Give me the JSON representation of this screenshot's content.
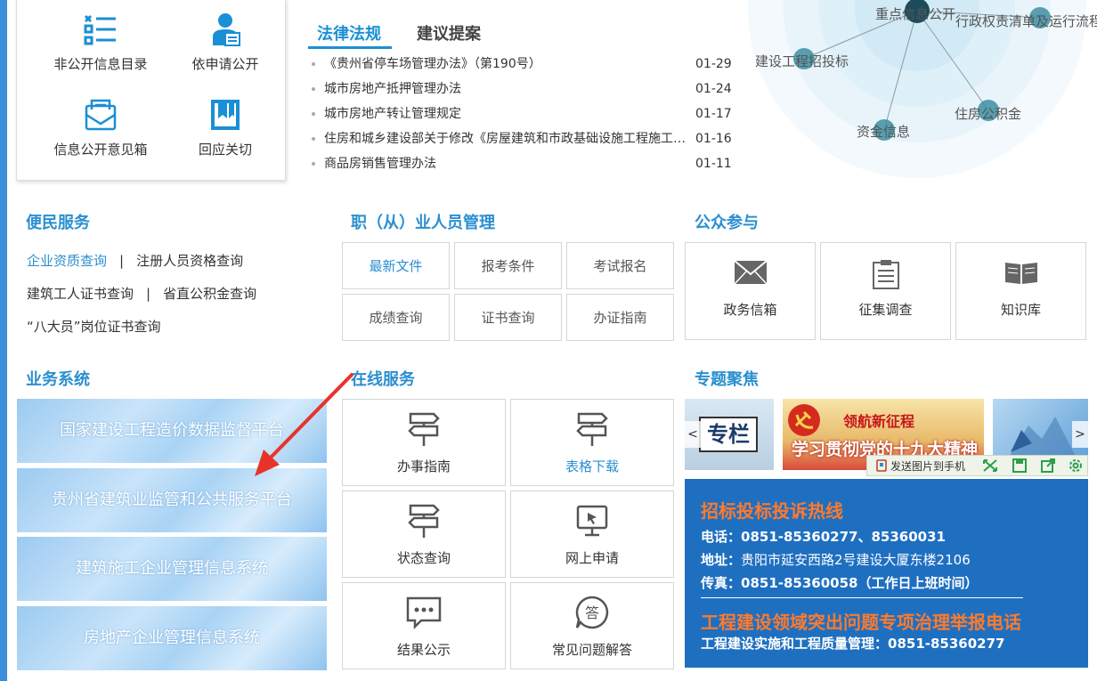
{
  "quick_links": [
    {
      "label": "非公开信息目录",
      "icon": "list-icon"
    },
    {
      "label": "依申请公开",
      "icon": "user-request-icon"
    },
    {
      "label": "信息公开意见箱",
      "icon": "mailbox-icon"
    },
    {
      "label": "回应关切",
      "icon": "bookmark-icon"
    }
  ],
  "law_tabs": [
    {
      "label": "法律法规",
      "active": true
    },
    {
      "label": "建议提案",
      "active": false
    }
  ],
  "laws": [
    {
      "title": "《贵州省停车场管理办法》（第190号）",
      "date": "01-29"
    },
    {
      "title": "城市房地产抵押管理办法",
      "date": "01-24"
    },
    {
      "title": "城市房地产转让管理规定",
      "date": "01-17"
    },
    {
      "title": "住房和城乡建设部关于修改《房屋建筑和市政基础设施工程施工招标投标管理办法》的决定",
      "date": "01-16"
    },
    {
      "title": "商品房销售管理办法",
      "date": "01-11"
    }
  ],
  "graph_labels": {
    "center": "重点信息公开",
    "top_right": "行政权责清单及运行流程",
    "left": "建设工程招投标",
    "bottom": "资金信息",
    "right": "住房公积金"
  },
  "convenience": {
    "title": "便民服务",
    "links": [
      {
        "label": "企业资质查询",
        "highlight": true
      },
      {
        "label": "注册人员资格查询",
        "highlight": false
      },
      {
        "label": "建筑工人证书查询",
        "highlight": false
      },
      {
        "label": "省直公积金查询",
        "highlight": false
      },
      {
        "label": "“八大员”岗位证书查询",
        "highlight": false
      }
    ],
    "separator": "|"
  },
  "personnel": {
    "title": "职（从）业人员管理",
    "items": [
      "最新文件",
      "报考条件",
      "考试报名",
      "成绩查询",
      "证书查询",
      "办证指南"
    ]
  },
  "public": {
    "title": "公众参与",
    "items": [
      {
        "label": "政务信箱",
        "icon": "envelope-icon"
      },
      {
        "label": "征集调查",
        "icon": "clipboard-icon"
      },
      {
        "label": "知识库",
        "icon": "book-icon"
      }
    ]
  },
  "business": {
    "title": "业务系统",
    "items": [
      "国家建设工程造价数据监督平台",
      "贵州省建筑业监管和公共服务平台",
      "建筑施工企业管理信息系统",
      "房地产企业管理信息系统"
    ]
  },
  "online": {
    "title": "在线服务",
    "items": [
      {
        "label": "办事指南",
        "icon": "signpost-icon"
      },
      {
        "label": "表格下载",
        "icon": "signpost-icon"
      },
      {
        "label": "状态查询",
        "icon": "signpost-icon"
      },
      {
        "label": "网上申请",
        "icon": "monitor-icon"
      },
      {
        "label": "结果公示",
        "icon": "chat-icon"
      },
      {
        "label": "常见问题解答",
        "icon": "answer-icon"
      }
    ]
  },
  "focus": {
    "title": "专题聚焦",
    "slides": {
      "left_text": "专栏",
      "main_line1": "领航新征程",
      "main_line2": "学习贯彻党的十九大精神"
    },
    "prev": "<",
    "next": ">",
    "toolbar_send": "发送图片到手机"
  },
  "hotline": {
    "title": "招标投标投诉热线",
    "phone_label": "电话：",
    "phone": "0851-85360277、85360031",
    "addr_label": "地址：",
    "addr": "贵阳市延安西路2号建设大厦东楼2106",
    "fax_label": "传真：",
    "fax": "0851-85360058（工作日上班时间）",
    "title2": "工程建设领域突出问题专项治理举报电话",
    "quality_label": "工程建设实施和工程质量管理：",
    "quality_phone": "0851-85360277"
  },
  "colors": {
    "accent": "#2a8fd0",
    "hotline_bg": "#1f6fc1",
    "hotline_title": "#ff7a2c",
    "arrow": "#e8332a"
  }
}
